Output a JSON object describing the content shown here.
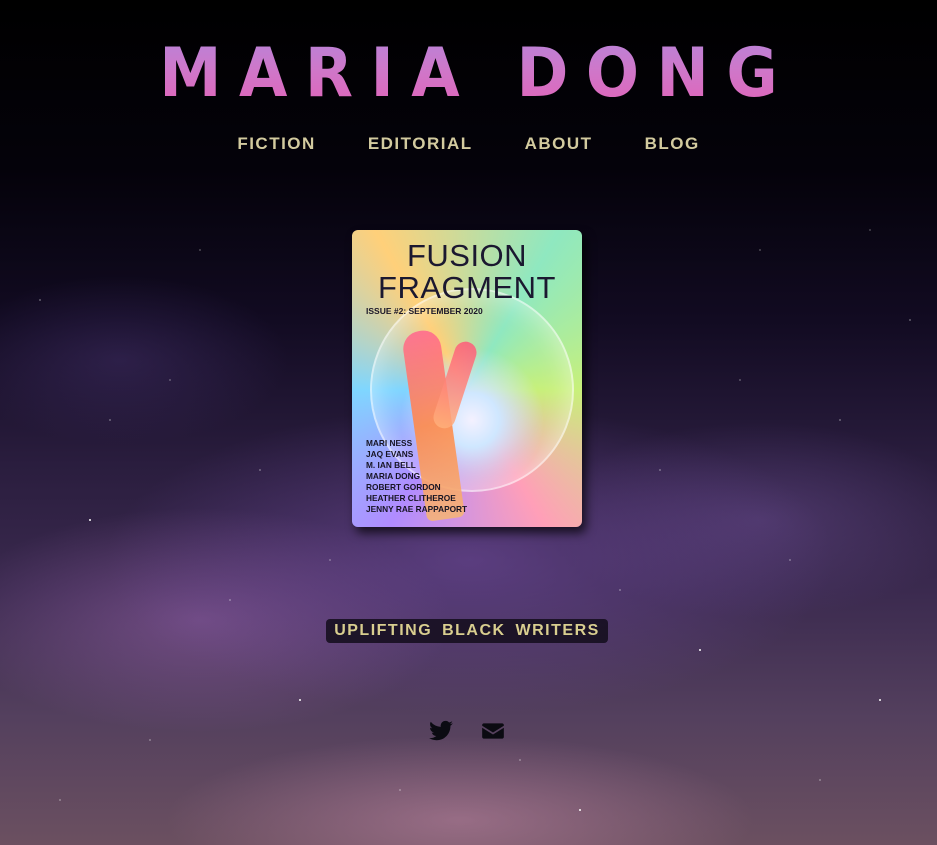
{
  "site": {
    "title": "MARIA DONG"
  },
  "nav": {
    "items": [
      {
        "label": "FICTION"
      },
      {
        "label": "EDITORIAL"
      },
      {
        "label": "ABOUT"
      },
      {
        "label": "BLOG"
      }
    ]
  },
  "featured": {
    "cover": {
      "title_line1": "FUSION",
      "title_line2": "FRAGMENT",
      "issue": "ISSUE #2: SEPTEMBER 2020",
      "authors": [
        "MARI NESS",
        "JAQ EVANS",
        "M. IAN BELL",
        "MARIA DONG",
        "ROBERT GORDON",
        "HEATHER CLITHEROE",
        "JENNY RAE RAPPAPORT"
      ]
    }
  },
  "banner": {
    "text": "UPLIFTING BLACK WRITERS"
  },
  "social": {
    "icons": [
      "twitter-icon",
      "envelope-icon"
    ]
  },
  "colors": {
    "title_gradient_top": "#b983d8",
    "title_gradient_bottom": "#e163b8",
    "nav_text": "#d3cb9f",
    "banner_text": "#d9ce8f",
    "banner_bg": "#140e1e",
    "icon_color": "#0b0b12"
  }
}
